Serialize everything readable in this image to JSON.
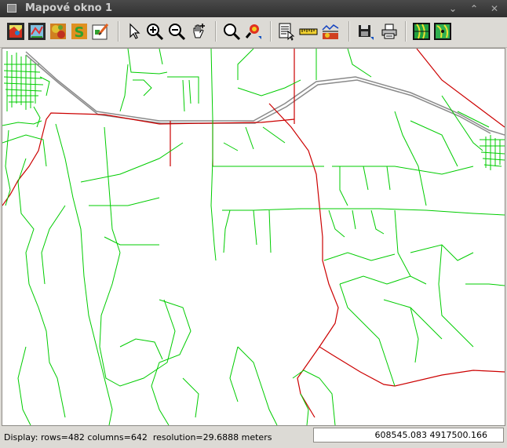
{
  "window": {
    "title": "Mapové okno 1"
  },
  "toolbar": {
    "tools": [
      {
        "name": "add-raster",
        "icon": "raster-map-icon"
      },
      {
        "name": "add-vector",
        "icon": "vector-map-icon"
      },
      {
        "name": "add-relief",
        "icon": "shaded-relief-icon"
      },
      {
        "name": "add-thematic",
        "icon": "thematic-map-icon"
      },
      {
        "name": "add-overlay",
        "icon": "overlay-icon"
      },
      {
        "name": "pointer",
        "icon": "pointer-icon"
      },
      {
        "name": "zoom-in",
        "icon": "zoom-in-icon"
      },
      {
        "name": "zoom-out",
        "icon": "zoom-out-icon"
      },
      {
        "name": "pan",
        "icon": "pan-hand-icon"
      },
      {
        "name": "zoom-back",
        "icon": "zoom-back-icon"
      },
      {
        "name": "zoom-menu",
        "icon": "zoom-menu-icon"
      },
      {
        "name": "query",
        "icon": "query-icon"
      },
      {
        "name": "measure",
        "icon": "ruler-icon"
      },
      {
        "name": "profile",
        "icon": "profile-icon"
      },
      {
        "name": "save",
        "icon": "floppy-disk-icon"
      },
      {
        "name": "print",
        "icon": "printer-icon"
      },
      {
        "name": "tool-1",
        "icon": "raster-map-2-icon"
      },
      {
        "name": "tool-2",
        "icon": "raster-map-3-icon"
      }
    ]
  },
  "status": {
    "display_text": "Display: rows=482 columns=642  resolution=29.6888 meters",
    "coordinates": "608545.083 4917500.166"
  },
  "colors": {
    "roads": "#00cc00",
    "highway": "#cc0000",
    "railway": "#888888",
    "background": "#ffffff"
  }
}
